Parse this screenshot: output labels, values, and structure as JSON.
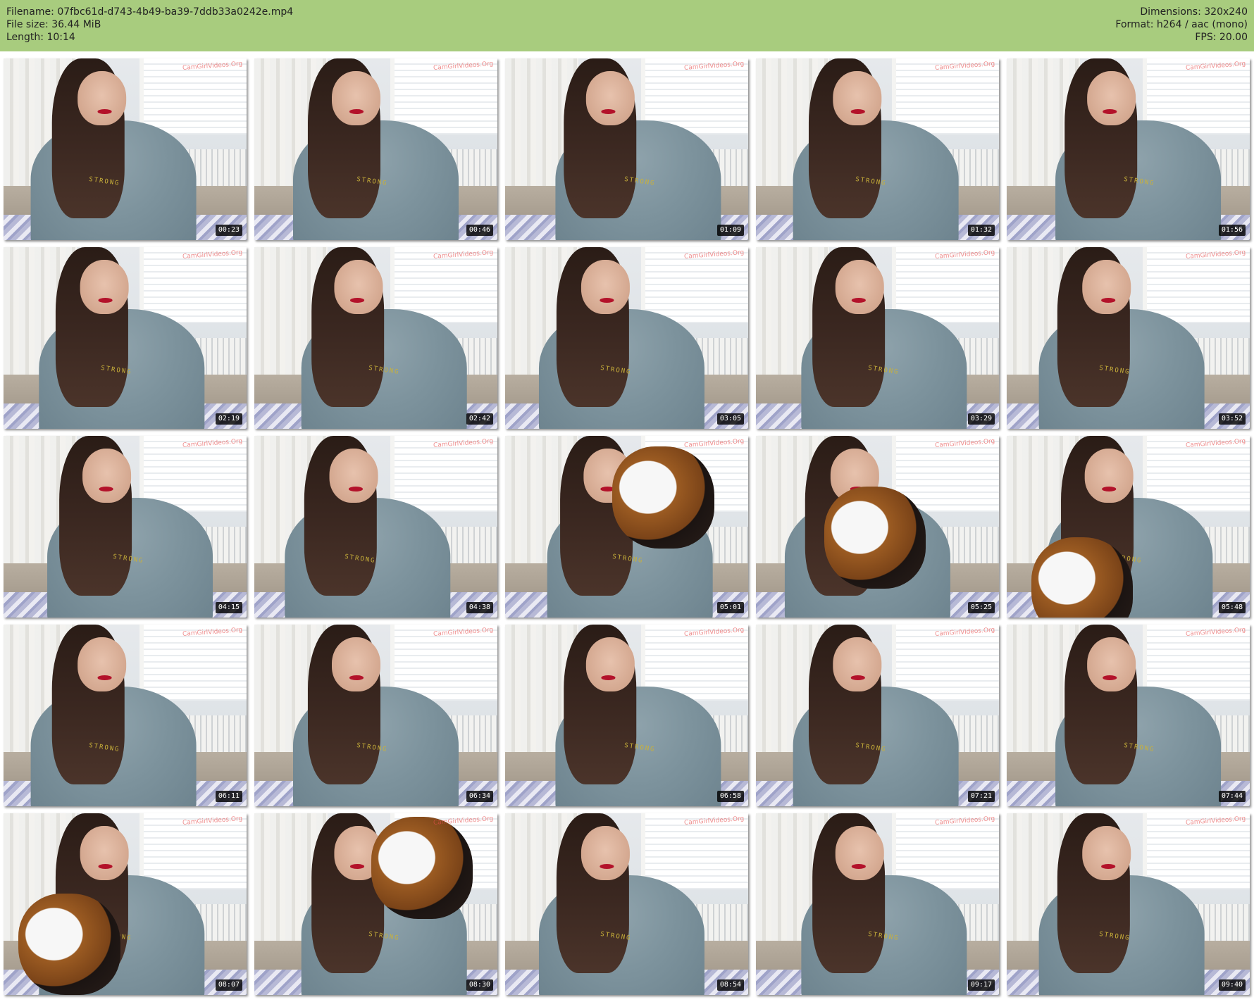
{
  "header": {
    "left": [
      {
        "label": "Filename:",
        "value": "07fbc61d-d743-4b49-ba39-7ddb33a0242e.mp4"
      },
      {
        "label": "File size:",
        "value": "36.44 MiB"
      },
      {
        "label": "Length:",
        "value": "10:14"
      }
    ],
    "right": [
      {
        "label": "Dimensions:",
        "value": "320x240"
      },
      {
        "label": "Format:",
        "value": "h264 / aac (mono)"
      },
      {
        "label": "FPS:",
        "value": "20.00"
      }
    ],
    "colors": {
      "bar_background": "#a8cc7e",
      "text": "#222222"
    }
  },
  "thumbnails": {
    "watermark_text": "CamGirlVideos.Org",
    "items": [
      {
        "time": "00:23"
      },
      {
        "time": "00:46"
      },
      {
        "time": "01:09"
      },
      {
        "time": "01:32"
      },
      {
        "time": "01:56"
      },
      {
        "time": "02:19"
      },
      {
        "time": "02:42"
      },
      {
        "time": "03:05"
      },
      {
        "time": "03:29"
      },
      {
        "time": "03:52"
      },
      {
        "time": "04:15"
      },
      {
        "time": "04:38"
      },
      {
        "time": "05:01"
      },
      {
        "time": "05:25"
      },
      {
        "time": "05:48"
      },
      {
        "time": "06:11"
      },
      {
        "time": "06:34"
      },
      {
        "time": "06:58"
      },
      {
        "time": "07:21"
      },
      {
        "time": "07:44"
      },
      {
        "time": "08:07"
      },
      {
        "time": "08:30"
      },
      {
        "time": "08:54"
      },
      {
        "time": "09:17"
      },
      {
        "time": "09:40"
      }
    ]
  },
  "hoodie_logo_text": "STRONG"
}
